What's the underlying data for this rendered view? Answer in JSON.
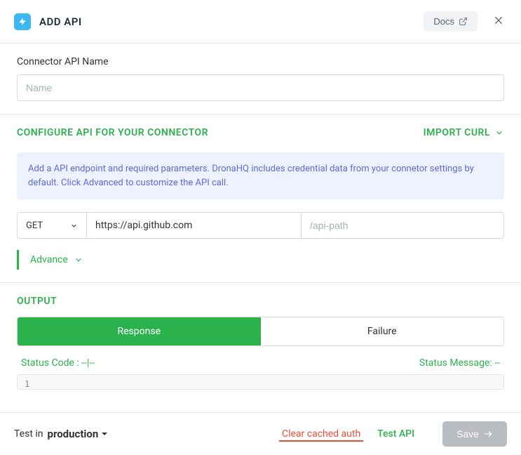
{
  "header": {
    "title": "ADD API",
    "docs_label": "Docs"
  },
  "connector": {
    "label": "Connector API Name",
    "name_placeholder": "Name",
    "name_value": ""
  },
  "configure": {
    "title": "CONFIGURE API FOR YOUR CONNECTOR",
    "import_curl": "IMPORT CURL",
    "info_text": "Add a API endpoint and required parameters. DronaHQ includes credential data from your connetor settings by default. Click Advanced to customize the API call.",
    "method": "GET",
    "base_url": "https://api.github.com",
    "path_placeholder": "/api-path",
    "path_value": "",
    "advance_label": "Advance"
  },
  "output": {
    "title": "OUTPUT",
    "tab_response": "Response",
    "tab_failure": "Failure",
    "status_code_label": "Status Code : ",
    "status_code_value": "--|--",
    "status_message_label": "Status Message: ",
    "status_message_value": "--",
    "line_no": "1"
  },
  "footer": {
    "test_in_label": "Test in",
    "environment": "production",
    "clear_cache": "Clear cached auth",
    "test_api": "Test API",
    "save": "Save"
  }
}
